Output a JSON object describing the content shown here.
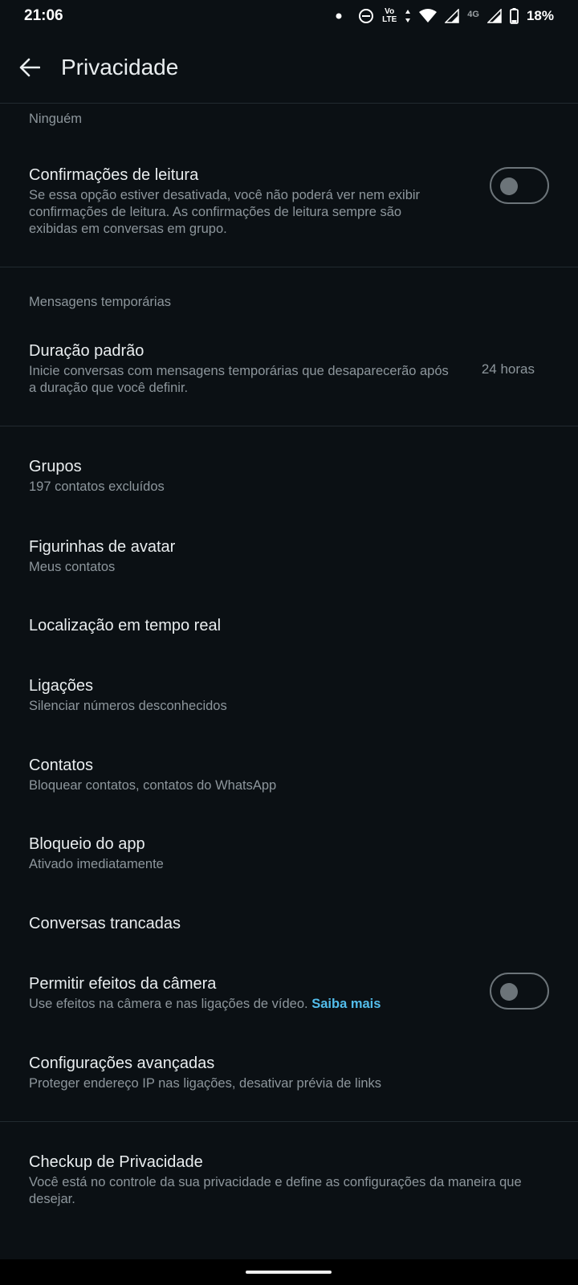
{
  "status_bar": {
    "time": "21:06",
    "volte_top": "Vo",
    "volte_bottom": "LTE",
    "network": "4G",
    "battery": "18%"
  },
  "app_bar": {
    "title": "Privacidade"
  },
  "items": {
    "ninguem": {
      "sub": "Ninguém"
    },
    "read_receipts": {
      "title": "Confirmações de leitura",
      "sub": "Se essa opção estiver desativada, você não poderá ver nem exibir confirmações de leitura. As confirmações de leitura sempre são exibidas em conversas em grupo.",
      "toggle_on": false
    },
    "temp_header": "Mensagens temporárias",
    "default_duration": {
      "title": "Duração padrão",
      "sub": "Inicie conversas com mensagens temporárias que desaparecerão após a duração que você definir.",
      "value": "24 horas"
    },
    "groups": {
      "title": "Grupos",
      "sub": "197 contatos excluídos"
    },
    "avatar_stickers": {
      "title": "Figurinhas de avatar",
      "sub": "Meus contatos"
    },
    "live_location": {
      "title": "Localização em tempo real"
    },
    "calls": {
      "title": "Ligações",
      "sub": "Silenciar números desconhecidos"
    },
    "contacts": {
      "title": "Contatos",
      "sub": "Bloquear contatos, contatos do WhatsApp"
    },
    "app_lock": {
      "title": "Bloqueio do app",
      "sub": "Ativado imediatamente"
    },
    "locked_chats": {
      "title": "Conversas trancadas"
    },
    "camera_effects": {
      "title": "Permitir efeitos da câmera",
      "sub": "Use efeitos na câmera e nas ligações de vídeo.",
      "link": "Saiba mais",
      "toggle_on": false
    },
    "advanced": {
      "title": "Configurações avançadas",
      "sub": "Proteger endereço IP nas ligações, desativar prévia de links"
    },
    "privacy_checkup": {
      "title": "Checkup de Privacidade",
      "sub": "Você está no controle da sua privacidade e define as configurações da maneira que desejar."
    }
  },
  "colors": {
    "background": "#0b1014",
    "primary_text": "#e9edef",
    "secondary_text": "#8d969c",
    "link": "#53bdeb",
    "toggle_off": "#6c7479"
  }
}
